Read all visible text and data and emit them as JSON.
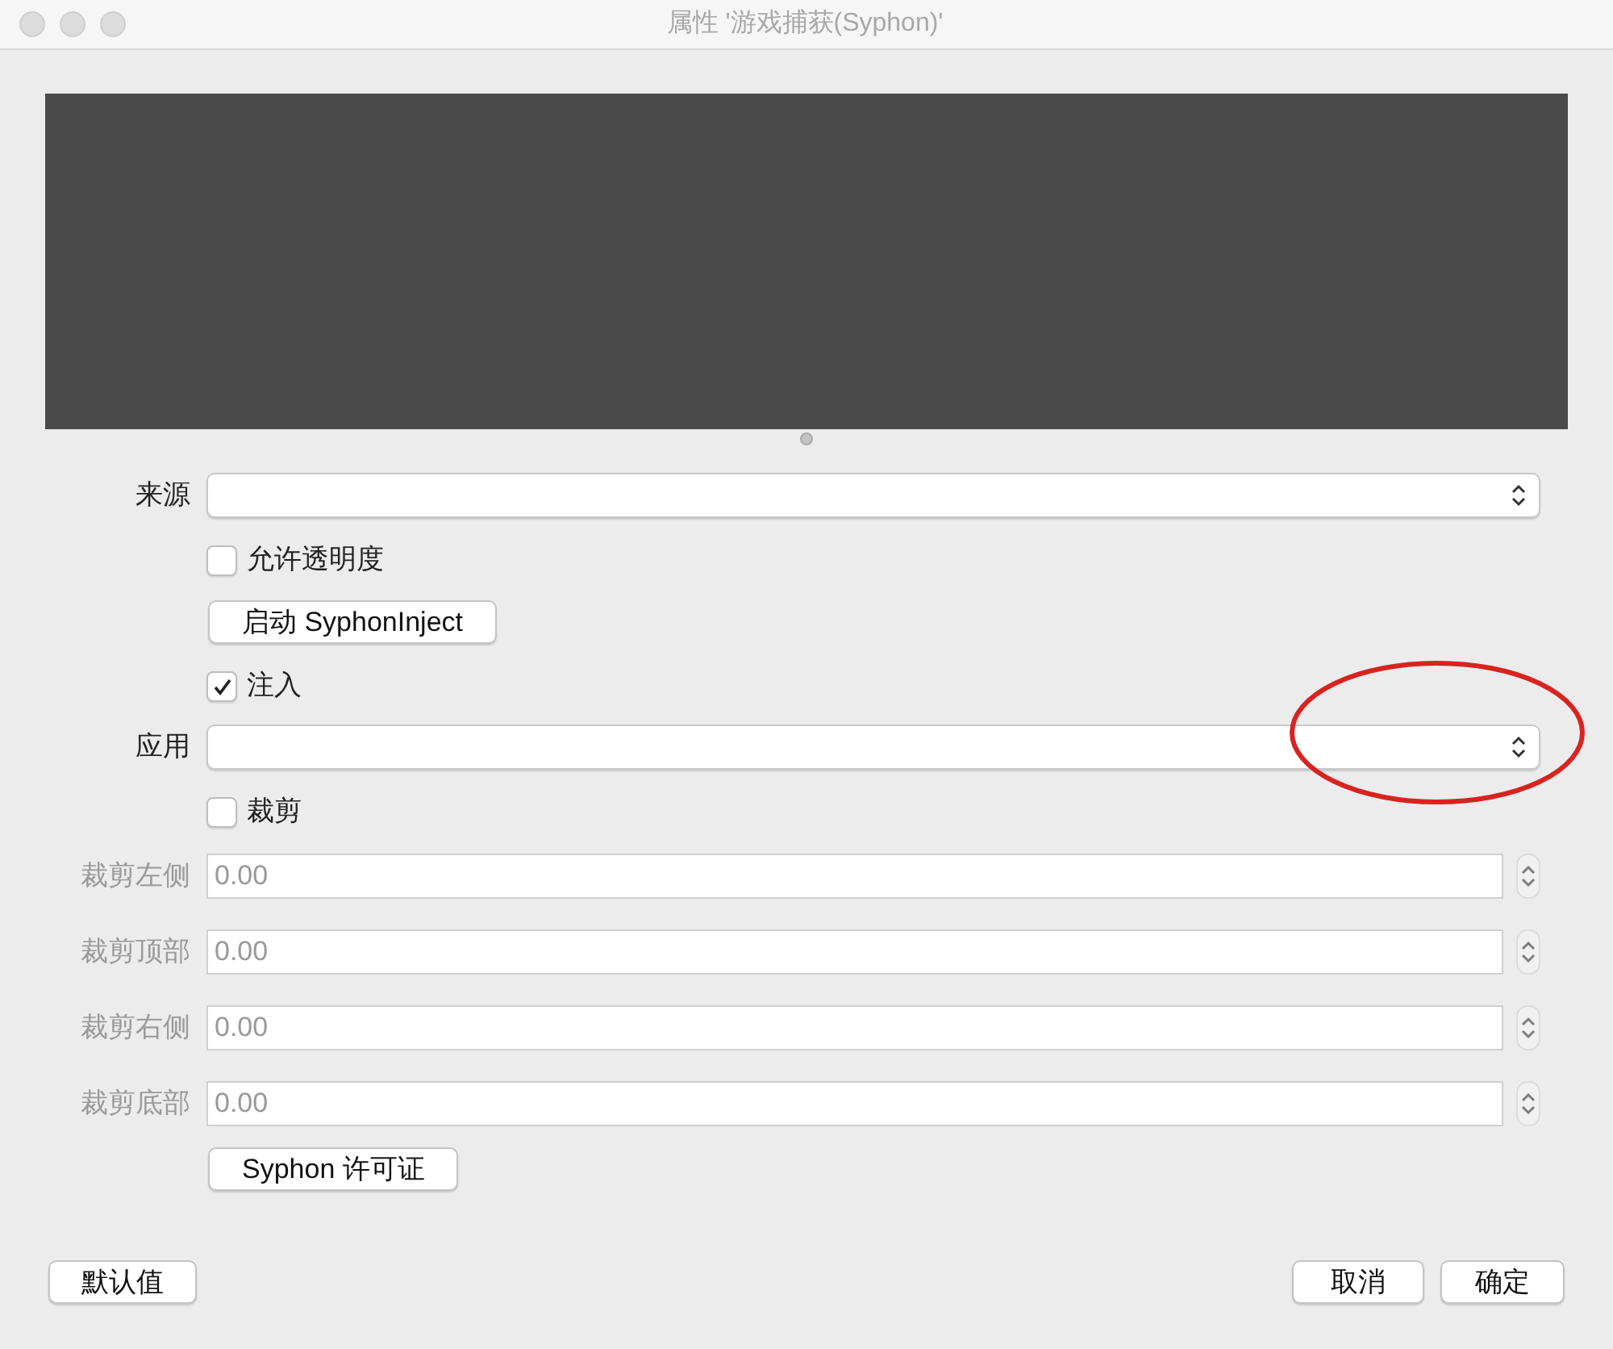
{
  "window": {
    "title": "属性 '游戏捕获(Syphon)'"
  },
  "form": [
    {
      "kind": "select",
      "label": "来源"
    },
    {
      "kind": "checkbox",
      "label": "允许透明度",
      "checked": false
    },
    {
      "kind": "button",
      "label": "启动 SyphonInject"
    },
    {
      "kind": "checkbox",
      "label": "注入",
      "checked": true
    },
    {
      "kind": "select",
      "label": "应用"
    },
    {
      "kind": "checkbox",
      "label": "裁剪",
      "checked": false
    },
    {
      "kind": "spin",
      "label": "裁剪左侧",
      "value": "0.00",
      "disabled": true
    },
    {
      "kind": "spin",
      "label": "裁剪顶部",
      "value": "0.00",
      "disabled": true
    },
    {
      "kind": "spin",
      "label": "裁剪右侧",
      "value": "0.00",
      "disabled": true
    },
    {
      "kind": "spin",
      "label": "裁剪底部",
      "value": "0.00",
      "disabled": true
    },
    {
      "kind": "button",
      "label": "Syphon 许可证"
    }
  ],
  "buttons": {
    "defaults": "默认值",
    "cancel": "取消",
    "ok": "确定"
  }
}
